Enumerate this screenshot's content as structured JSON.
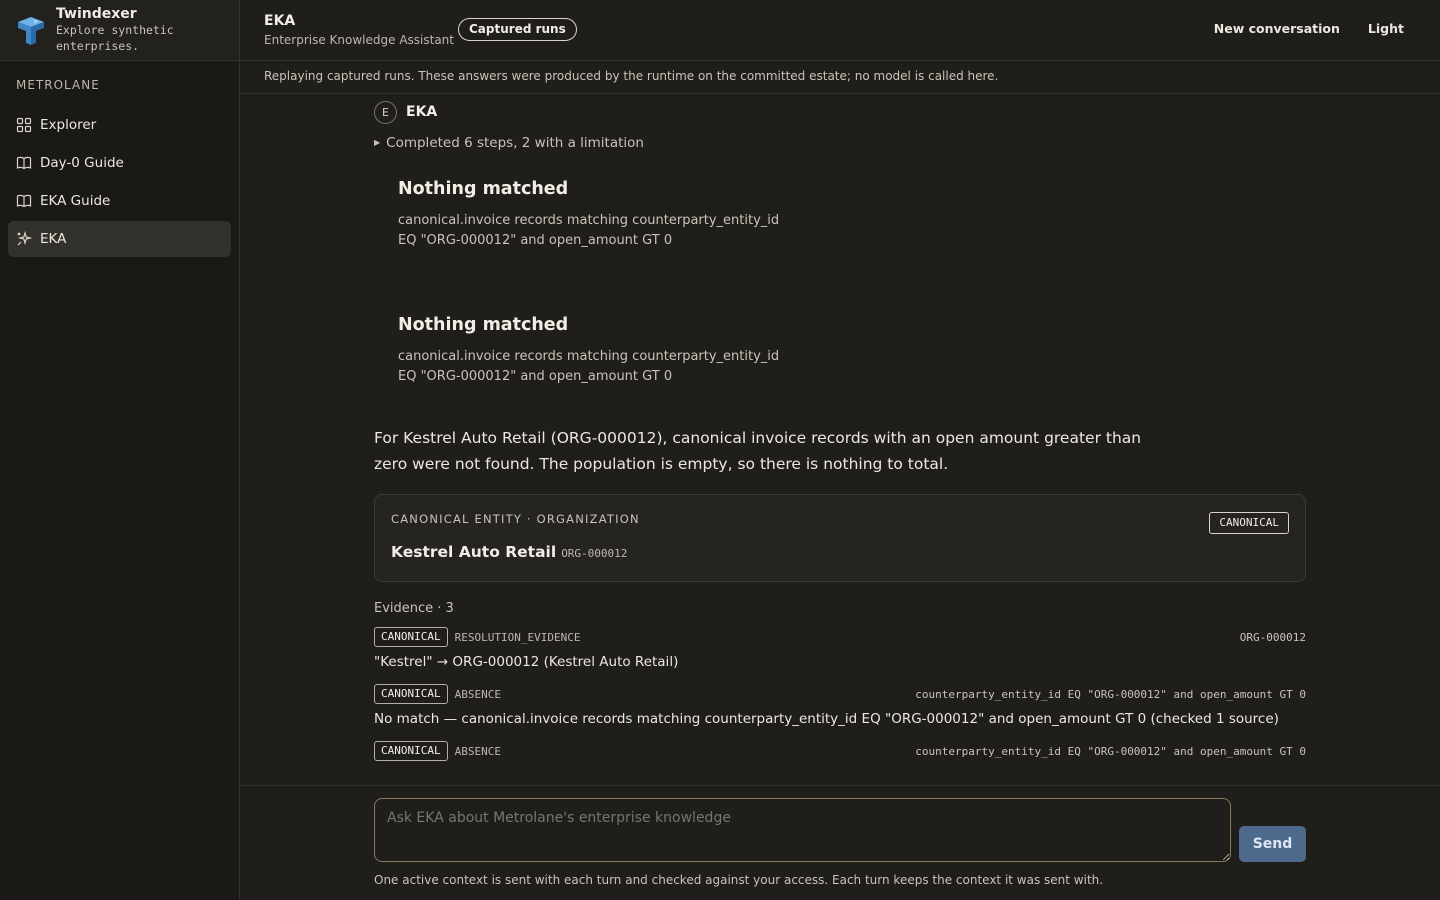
{
  "brand": {
    "title": "Twindexer",
    "subtitle": "Explore synthetic enterprises."
  },
  "sidebar": {
    "org_label": "METROLANE",
    "items": [
      {
        "label": "Explorer",
        "icon": "grid-icon"
      },
      {
        "label": "Day-0 Guide",
        "icon": "book-icon"
      },
      {
        "label": "EKA Guide",
        "icon": "book-icon"
      },
      {
        "label": "EKA",
        "icon": "sparkle-icon",
        "active": true
      }
    ]
  },
  "header": {
    "title": "EKA",
    "subtitle": "Enterprise Knowledge Assistant",
    "badge": "Captured runs",
    "new_conversation": "New conversation",
    "theme_toggle": "Light"
  },
  "notice": "Replaying captured runs. These answers were produced by the runtime on the committed estate; no model is called here.",
  "message": {
    "avatar": "E",
    "author": "EKA",
    "steps": "Completed 6 steps, 2 with a limitation",
    "nomatch": [
      {
        "title": "Nothing matched",
        "detail": "canonical.invoice records matching counterparty_entity_id EQ \"ORG-000012\" and open_amount GT 0"
      },
      {
        "title": "Nothing matched",
        "detail": "canonical.invoice records matching counterparty_entity_id EQ \"ORG-000012\" and open_amount GT 0"
      }
    ],
    "answer": "For Kestrel Auto Retail (ORG-000012), canonical invoice records with an open amount greater than zero were not found. The population is empty, so there is nothing to total.",
    "entity": {
      "label": "CANONICAL ENTITY · ORGANIZATION",
      "badge": "CANONICAL",
      "name": "Kestrel Auto Retail",
      "id": "ORG-000012"
    },
    "evidence_label": "Evidence · 3",
    "evidence": [
      {
        "chip": "CANONICAL",
        "kind": "RESOLUTION_EVIDENCE",
        "ref": "ORG-000012",
        "text": "\"Kestrel\" → ORG-000012 (Kestrel Auto Retail)"
      },
      {
        "chip": "CANONICAL",
        "kind": "ABSENCE",
        "ref": "counterparty_entity_id EQ \"ORG-000012\" and open_amount GT 0",
        "text": "No match — canonical.invoice records matching counterparty_entity_id EQ \"ORG-000012\" and open_amount GT 0 (checked 1 source)"
      },
      {
        "chip": "CANONICAL",
        "kind": "ABSENCE",
        "ref": "counterparty_entity_id EQ \"ORG-000012\" and open_amount GT 0",
        "text": ""
      }
    ]
  },
  "composer": {
    "placeholder": "Ask EKA about Metrolane's enterprise knowledge",
    "send": "Send",
    "note": "One active context is sent with each turn and checked against your access. Each turn keeps the context it was sent with."
  },
  "colors": {
    "accent": "#4d6a8c",
    "background": "#1f1e1b",
    "sidebar": "#1a1916"
  }
}
